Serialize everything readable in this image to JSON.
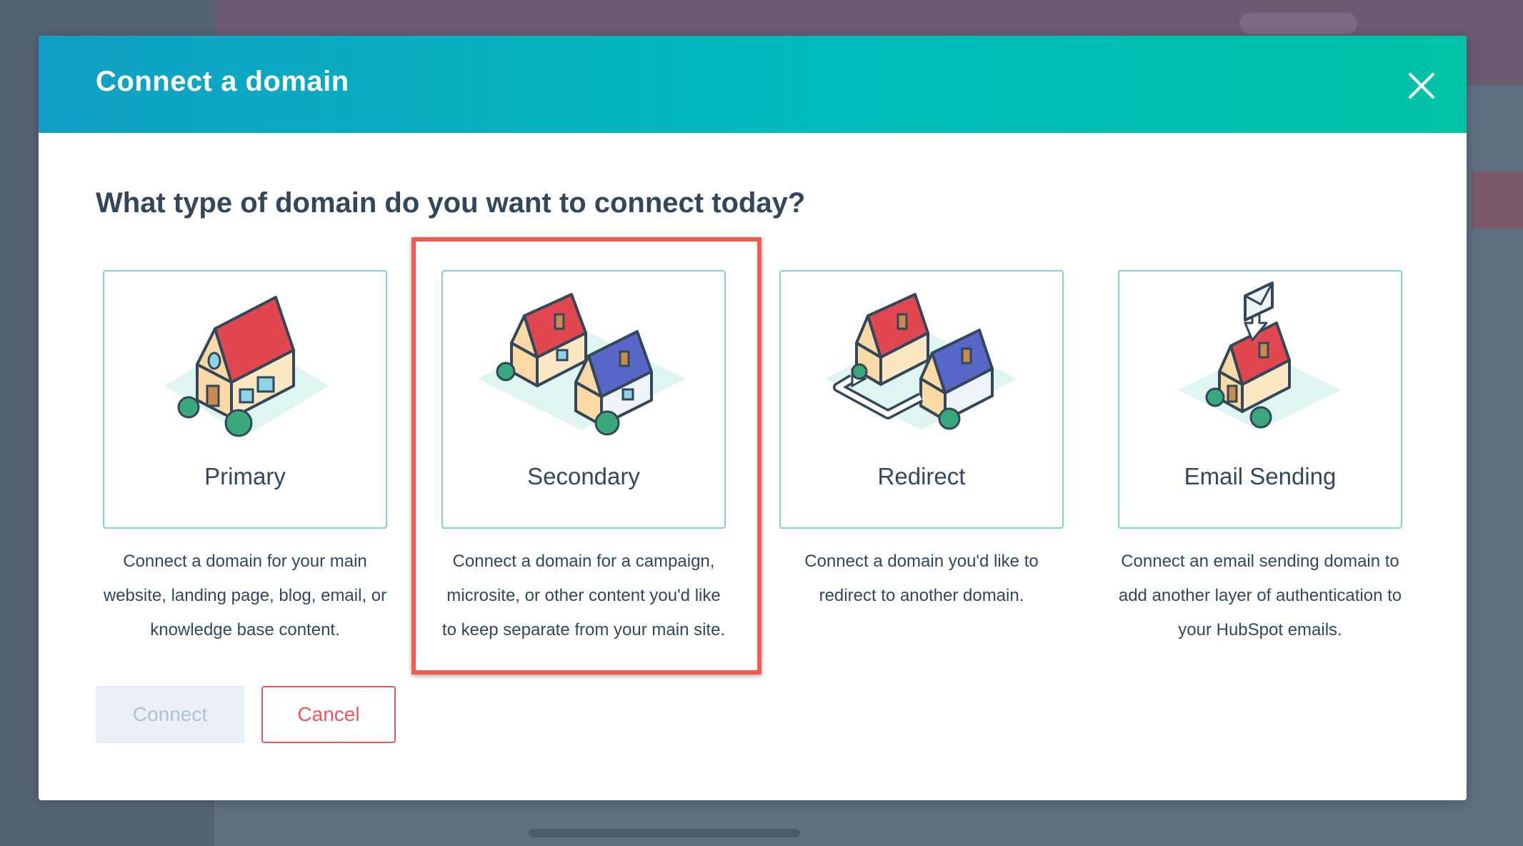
{
  "modal": {
    "title": "Connect a domain",
    "question": "What type of domain do you want to connect today?"
  },
  "options": [
    {
      "label": "Primary",
      "icon": "house-icon",
      "lines": [
        "Connect a domain for your main",
        "website, landing page, blog, email, or",
        "knowledge base content."
      ]
    },
    {
      "label": "Secondary",
      "icon": "two-houses-icon",
      "lines": [
        "Connect a domain for a campaign,",
        "microsite, or other content you'd like",
        "to keep separate from your main site."
      ]
    },
    {
      "label": "Redirect",
      "icon": "redirect-houses-icon",
      "lines": [
        "Connect a domain you'd like to",
        "redirect to another domain."
      ]
    },
    {
      "label": "Email Sending",
      "icon": "email-house-icon",
      "lines": [
        "Connect an email sending domain to",
        "add another layer of authentication to",
        "your HubSpot emails."
      ]
    }
  ],
  "buttons": {
    "connect": "Connect",
    "cancel": "Cancel"
  },
  "colors": {
    "header_start": "#0f9fc4",
    "header_end": "#00c3a7",
    "card_border": "#7fd1de",
    "highlight": "#f25c4e",
    "cancel": "#f2545b",
    "text": "#33475b"
  }
}
